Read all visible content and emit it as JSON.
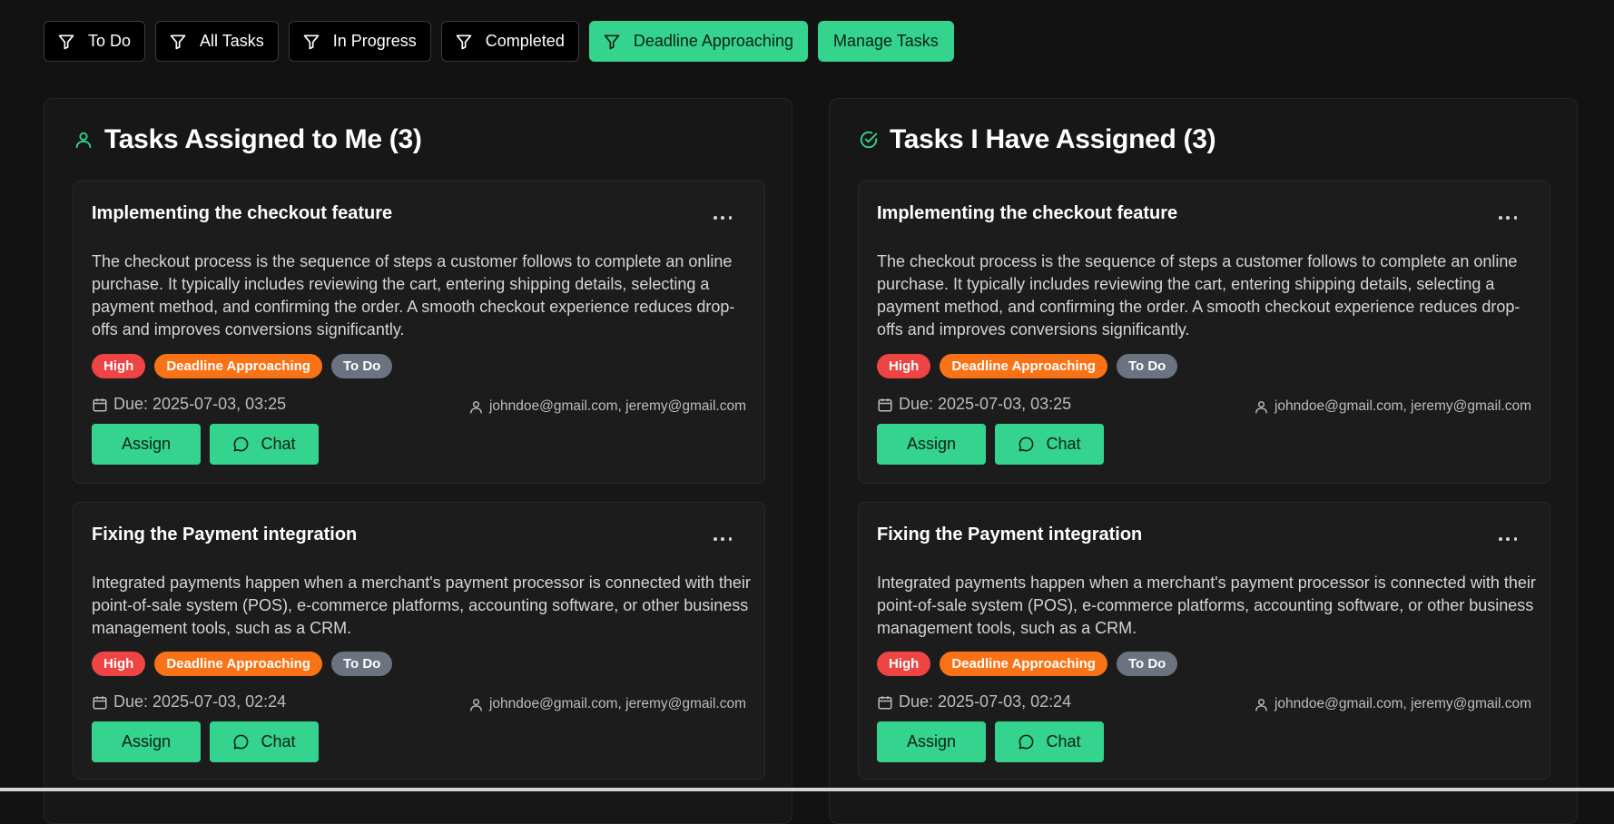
{
  "filters": [
    {
      "label": "To Do",
      "icon": "filter-icon",
      "active": false
    },
    {
      "label": "All Tasks",
      "icon": "filter-icon",
      "active": false
    },
    {
      "label": "In Progress",
      "icon": "filter-icon",
      "active": false
    },
    {
      "label": "Completed",
      "icon": "filter-icon",
      "active": false
    },
    {
      "label": "Deadline Approaching",
      "icon": "filter-icon",
      "active": true
    }
  ],
  "manage_label": "Manage Tasks",
  "colors": {
    "accent": "#34d48e",
    "high": "#ef4444",
    "deadline": "#f97316",
    "todo": "#6b7280",
    "background": "#121212"
  },
  "panels": [
    {
      "title": "Tasks Assigned to Me (3)",
      "icon": "user-icon",
      "cards": [
        {
          "title": "Implementing the checkout feature",
          "description": "The checkout process is the sequence of steps a customer follows to complete an online purchase. It typically includes reviewing the cart, entering shipping details, selecting a payment method, and confirming the order. A smooth checkout experience reduces drop-offs and improves conversions significantly.",
          "badges": [
            "High",
            "Deadline Approaching",
            "To Do"
          ],
          "due": "Due: 2025-07-03, 03:25",
          "assignees": "johndoe@gmail.com, jeremy@gmail.com",
          "assign_label": "Assign",
          "chat_label": "Chat"
        },
        {
          "title": "Fixing the Payment integration",
          "description": "Integrated payments happen when a merchant's payment processor is connected with their point-of-sale system (POS), e-commerce platforms, accounting software, or other business management tools, such as a CRM.",
          "badges": [
            "High",
            "Deadline Approaching",
            "To Do"
          ],
          "due": "Due: 2025-07-03, 02:24",
          "assignees": "johndoe@gmail.com, jeremy@gmail.com",
          "assign_label": "Assign",
          "chat_label": "Chat"
        }
      ]
    },
    {
      "title": "Tasks I Have Assigned (3)",
      "icon": "check-circle-icon",
      "cards": [
        {
          "title": "Implementing the checkout feature",
          "description": "The checkout process is the sequence of steps a customer follows to complete an online purchase. It typically includes reviewing the cart, entering shipping details, selecting a payment method, and confirming the order. A smooth checkout experience reduces drop-offs and improves conversions significantly.",
          "badges": [
            "High",
            "Deadline Approaching",
            "To Do"
          ],
          "due": "Due: 2025-07-03, 03:25",
          "assignees": "johndoe@gmail.com, jeremy@gmail.com",
          "assign_label": "Assign",
          "chat_label": "Chat"
        },
        {
          "title": "Fixing the Payment integration",
          "description": "Integrated payments happen when a merchant's payment processor is connected with their point-of-sale system (POS), e-commerce platforms, accounting software, or other business management tools, such as a CRM.",
          "badges": [
            "High",
            "Deadline Approaching",
            "To Do"
          ],
          "due": "Due: 2025-07-03, 02:24",
          "assignees": "johndoe@gmail.com, jeremy@gmail.com",
          "assign_label": "Assign",
          "chat_label": "Chat"
        }
      ]
    }
  ]
}
